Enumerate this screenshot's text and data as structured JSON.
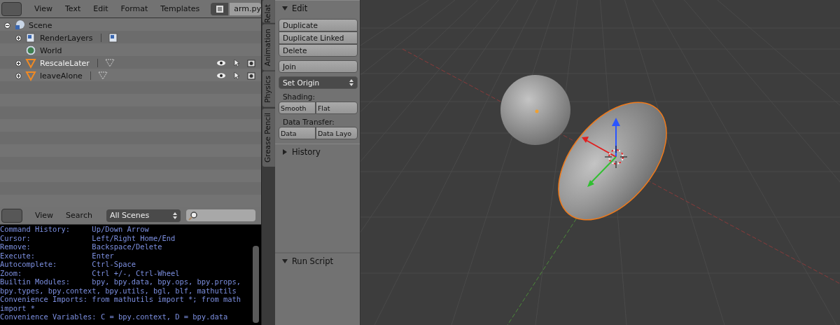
{
  "text_editor_header": {
    "menus": [
      "View",
      "Text",
      "Edit",
      "Format",
      "Templates"
    ],
    "file_name": "arm.py"
  },
  "outliner": {
    "items": [
      {
        "name": "Scene",
        "kind": "scene",
        "expanded": true,
        "children": [
          {
            "name": "RenderLayers",
            "kind": "renderlayers",
            "expanded": false
          },
          {
            "name": "World",
            "kind": "world"
          },
          {
            "name": "RescaleLater",
            "kind": "mesh",
            "expanded": false
          },
          {
            "name": "leaveAlone",
            "kind": "mesh",
            "expanded": false
          }
        ]
      }
    ]
  },
  "outliner_header": {
    "menus": [
      "View",
      "Search"
    ],
    "display_mode": "All Scenes"
  },
  "console": {
    "lines": [
      "Command History:     Up/Down Arrow",
      "Cursor:              Left/Right Home/End",
      "Remove:              Backspace/Delete",
      "Execute:             Enter",
      "Autocomplete:        Ctrl-Space",
      "Zoom:                Ctrl +/-, Ctrl-Wheel",
      "Builtin Modules:     bpy, bpy.data, bpy.ops, bpy.props,",
      "bpy.types, bpy.context, bpy.utils, bgl, blf, mathutils",
      "Convenience Imports: from mathutils import *; from math",
      "import *",
      "Convenience Variables: C = bpy.context, D = bpy.data"
    ]
  },
  "tool_tabs": [
    "Relat",
    "Animation",
    "Physics",
    "Grease Pencil"
  ],
  "tool_panels": [
    {
      "title": "Edit",
      "expanded": true,
      "groups": [
        {
          "kind": "column",
          "buttons": [
            "Duplicate",
            "Duplicate Linked",
            "Delete"
          ]
        },
        {
          "kind": "column",
          "buttons": [
            "Join"
          ]
        },
        {
          "kind": "menu",
          "value": "Set Origin"
        },
        {
          "kind": "row",
          "label": "Shading:",
          "buttons": [
            "Smooth",
            "Flat"
          ]
        },
        {
          "kind": "row",
          "label": "Data Transfer:",
          "buttons": [
            "Data",
            "Data Layo"
          ]
        }
      ]
    },
    {
      "title": "History",
      "expanded": false
    }
  ],
  "bottom_panel": {
    "title": "Run Script",
    "expanded": true
  }
}
